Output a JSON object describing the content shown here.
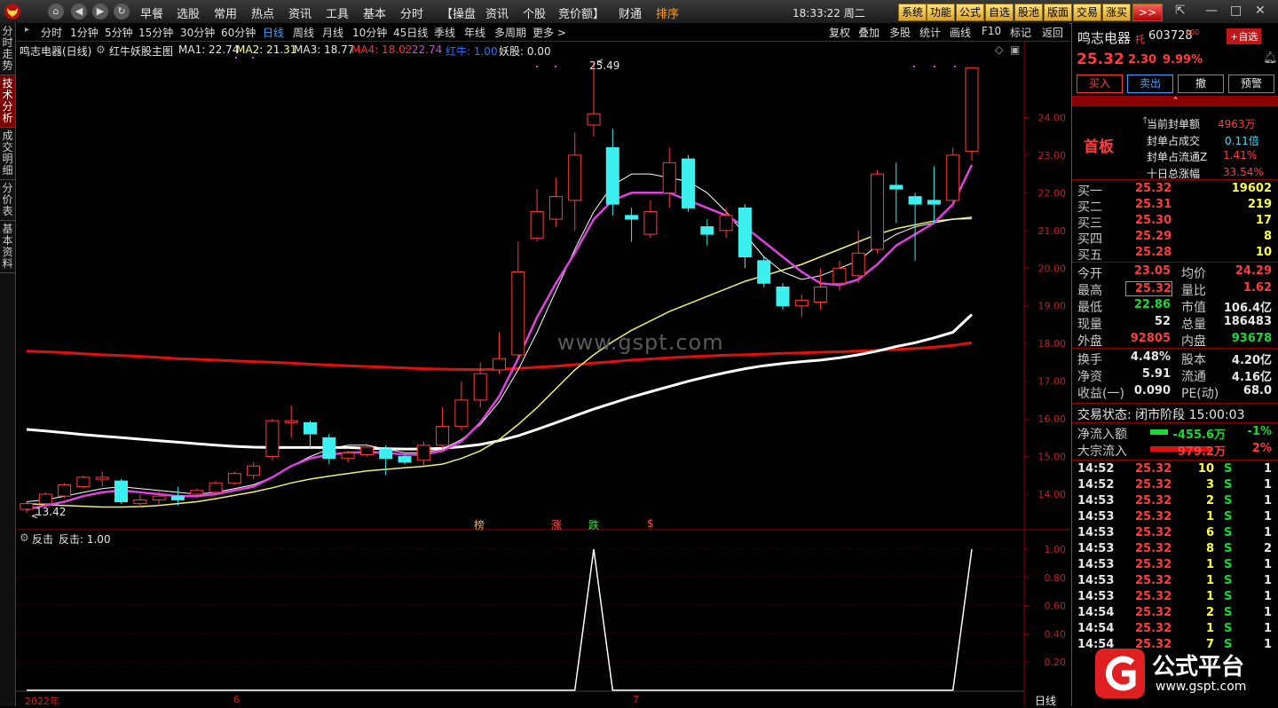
{
  "topbar": {
    "menus": [
      "早餐",
      "选股",
      "常用",
      "热点",
      "资讯",
      "工具",
      "基本",
      "分时",
      "【操盘",
      "资讯",
      "个股",
      "竞价额】",
      "财通",
      "排序"
    ],
    "clock": "18:33:22 周二",
    "buttons": [
      "系统",
      "功能",
      "公式",
      "自选",
      "股池",
      "版面",
      "交易",
      "涨买",
      ">>"
    ],
    "win_controls": [
      "⇱",
      "—",
      "□",
      "✕"
    ]
  },
  "left_tabs": [
    "分时走势",
    "技术分析",
    "成交明细",
    "分价表",
    "基本资料"
  ],
  "period_bar": {
    "periods": [
      "分时",
      "1分钟",
      "5分钟",
      "15分钟",
      "30分钟",
      "60分钟",
      "日线",
      "周线",
      "月线",
      "10分钟",
      "45日线",
      "季线",
      "年线",
      "多周期",
      "更多 >"
    ],
    "selected": "日线",
    "right": [
      "复权",
      "叠加",
      "多股",
      "统计",
      "画线",
      "F10",
      "标记",
      "返回"
    ]
  },
  "info_line": {
    "stock": "鸣志电器(日线)",
    "indicator": "红牛妖股主图",
    "ma1": "MA1: 22.74",
    "ma2": "MA2: 21.31",
    "ma3": "MA3: 18.77",
    "ma4": "MA4: 18.02",
    "val5": ": 22.74",
    "hongniu": "红牛: 1.00",
    "yaogu": "妖股: 0.00"
  },
  "sub_info": {
    "name": "反击",
    "value": "反击: 1.00"
  },
  "chart_labels": {
    "high_marker": "25.49",
    "low_marker": "13.42",
    "signals": [
      "榜",
      "涨",
      "跌",
      "$"
    ],
    "x_labels": [
      "2022年",
      "6",
      "7"
    ],
    "period_tag": "日线",
    "watermark": "www.gspt.com"
  },
  "colors": {
    "up": "#ff3c3c",
    "down": "#3cf0f0",
    "ma_magenta": "#e040e0",
    "ma_yellow": "#f0f070",
    "ma_white": "#ffffff",
    "ma_red": "#e01010",
    "accent_red": "#ff3c3c",
    "accent_green": "#18d838"
  },
  "chart_data": {
    "type": "candlestick",
    "ylim": [
      13.2,
      25.8
    ],
    "yticks": [
      14.0,
      15.0,
      16.0,
      17.0,
      18.0,
      19.0,
      20.0,
      21.0,
      22.0,
      23.0,
      24.0
    ],
    "candles": [
      [
        13.6,
        13.75,
        13.5,
        13.8
      ],
      [
        13.75,
        14.0,
        13.7,
        14.05
      ],
      [
        13.95,
        14.25,
        13.9,
        14.3
      ],
      [
        14.2,
        14.45,
        14.15,
        14.5
      ],
      [
        14.4,
        14.45,
        14.2,
        14.6
      ],
      [
        14.35,
        13.8,
        13.75,
        14.4
      ],
      [
        13.75,
        13.85,
        13.65,
        14.0
      ],
      [
        13.85,
        13.95,
        13.7,
        14.1
      ],
      [
        13.95,
        13.85,
        13.7,
        14.2
      ],
      [
        14.0,
        14.1,
        13.9,
        14.15
      ],
      [
        14.05,
        14.3,
        14.0,
        14.35
      ],
      [
        14.3,
        14.55,
        14.25,
        14.6
      ],
      [
        14.5,
        14.75,
        14.4,
        14.85
      ],
      [
        15.0,
        15.95,
        14.9,
        16.0
      ],
      [
        15.9,
        15.95,
        15.5,
        16.35
      ],
      [
        15.9,
        15.6,
        15.2,
        15.95
      ],
      [
        15.5,
        14.95,
        14.8,
        15.6
      ],
      [
        14.95,
        15.1,
        14.85,
        15.15
      ],
      [
        15.05,
        15.25,
        15.0,
        15.3
      ],
      [
        15.2,
        14.95,
        14.5,
        15.3
      ],
      [
        15.0,
        14.85,
        14.8,
        15.05
      ],
      [
        14.9,
        15.3,
        14.75,
        15.4
      ],
      [
        15.3,
        15.8,
        15.2,
        16.3
      ],
      [
        15.8,
        16.5,
        15.7,
        17.0
      ],
      [
        16.5,
        17.2,
        16.3,
        17.5
      ],
      [
        17.3,
        17.6,
        17.2,
        18.3
      ],
      [
        17.7,
        19.9,
        17.6,
        20.7
      ],
      [
        20.8,
        21.5,
        20.7,
        22.1
      ],
      [
        21.3,
        21.9,
        21.1,
        22.4
      ],
      [
        21.8,
        23.0,
        21.0,
        23.6
      ],
      [
        23.8,
        24.1,
        23.5,
        25.49
      ],
      [
        23.2,
        21.7,
        21.4,
        23.7
      ],
      [
        21.4,
        21.3,
        20.7,
        21.6
      ],
      [
        20.9,
        21.5,
        20.8,
        21.8
      ],
      [
        22.0,
        22.8,
        21.6,
        23.2
      ],
      [
        22.9,
        21.6,
        21.5,
        23.0
      ],
      [
        21.1,
        20.9,
        20.6,
        21.3
      ],
      [
        21.0,
        21.4,
        20.8,
        21.6
      ],
      [
        21.6,
        20.3,
        20.0,
        21.7
      ],
      [
        20.2,
        19.6,
        19.5,
        20.3
      ],
      [
        19.5,
        19.0,
        18.9,
        19.6
      ],
      [
        19.0,
        19.15,
        18.7,
        19.3
      ],
      [
        19.1,
        19.5,
        18.9,
        20.0
      ],
      [
        19.6,
        20.0,
        19.4,
        20.2
      ],
      [
        19.8,
        20.4,
        19.6,
        21.0
      ],
      [
        20.5,
        22.5,
        20.4,
        22.6
      ],
      [
        22.2,
        22.1,
        21.2,
        22.8
      ],
      [
        21.9,
        21.7,
        20.2,
        22.0
      ],
      [
        21.8,
        21.7,
        21.2,
        22.7
      ],
      [
        21.8,
        23.0,
        21.6,
        23.2
      ],
      [
        23.1,
        25.32,
        22.86,
        25.32
      ]
    ],
    "ma_magenta": [
      13.6,
      13.7,
      13.8,
      13.95,
      14.05,
      14.1,
      14.05,
      14.0,
      13.95,
      13.95,
      14.0,
      14.1,
      14.2,
      14.45,
      14.75,
      14.95,
      15.05,
      15.1,
      15.12,
      15.1,
      15.05,
      15.05,
      15.15,
      15.4,
      15.9,
      16.6,
      17.6,
      18.7,
      19.6,
      20.4,
      21.3,
      21.8,
      22.0,
      22.0,
      22.0,
      21.8,
      21.6,
      21.4,
      21.1,
      20.7,
      20.3,
      19.9,
      19.6,
      19.55,
      19.7,
      20.1,
      20.6,
      20.9,
      21.2,
      21.7,
      22.74
    ],
    "ma_white_thin": [
      13.8,
      13.85,
      13.95,
      14.05,
      14.15,
      14.2,
      14.15,
      14.1,
      14.05,
      14.0,
      14.05,
      14.15,
      14.25,
      14.45,
      14.75,
      15.0,
      15.2,
      15.3,
      15.3,
      15.2,
      15.1,
      15.1,
      15.2,
      15.45,
      15.85,
      16.45,
      17.3,
      18.3,
      19.4,
      20.5,
      21.5,
      22.2,
      22.5,
      22.5,
      22.4,
      22.3,
      22.0,
      21.5,
      20.9,
      20.3,
      19.9,
      19.7,
      19.8,
      20.0,
      20.2,
      20.6,
      20.9,
      21.1,
      21.2,
      21.3,
      21.31
    ],
    "ma_yellow": [
      13.75,
      13.72,
      13.7,
      13.68,
      13.66,
      13.66,
      13.67,
      13.7,
      13.75,
      13.8,
      13.88,
      13.97,
      14.06,
      14.17,
      14.3,
      14.4,
      14.48,
      14.55,
      14.62,
      14.66,
      14.7,
      14.74,
      14.8,
      14.95,
      15.15,
      15.45,
      15.85,
      16.3,
      16.8,
      17.3,
      17.7,
      18.05,
      18.35,
      18.6,
      18.85,
      19.05,
      19.25,
      19.45,
      19.65,
      19.8,
      19.95,
      20.1,
      20.3,
      20.5,
      20.7,
      20.9,
      21.05,
      21.15,
      21.25,
      21.3,
      21.35
    ],
    "ma_white_thick": [
      15.72,
      15.68,
      15.63,
      15.58,
      15.54,
      15.5,
      15.46,
      15.42,
      15.38,
      15.34,
      15.3,
      15.27,
      15.25,
      15.24,
      15.24,
      15.24,
      15.24,
      15.24,
      15.22,
      15.21,
      15.2,
      15.2,
      15.22,
      15.26,
      15.32,
      15.42,
      15.55,
      15.72,
      15.9,
      16.08,
      16.26,
      16.42,
      16.58,
      16.72,
      16.86,
      17.0,
      17.12,
      17.23,
      17.33,
      17.41,
      17.47,
      17.52,
      17.56,
      17.62,
      17.7,
      17.8,
      17.92,
      18.02,
      18.15,
      18.3,
      18.77
    ],
    "ma_red": [
      17.8,
      17.78,
      17.76,
      17.73,
      17.7,
      17.68,
      17.66,
      17.63,
      17.6,
      17.58,
      17.56,
      17.54,
      17.52,
      17.5,
      17.48,
      17.45,
      17.43,
      17.41,
      17.39,
      17.37,
      17.35,
      17.33,
      17.32,
      17.31,
      17.31,
      17.32,
      17.34,
      17.37,
      17.4,
      17.44,
      17.48,
      17.52,
      17.56,
      17.59,
      17.62,
      17.65,
      17.67,
      17.69,
      17.7,
      17.72,
      17.74,
      17.75,
      17.77,
      17.78,
      17.8,
      17.82,
      17.84,
      17.87,
      17.9,
      17.95,
      18.02
    ],
    "sub": {
      "name": "反击",
      "ylim": [
        0,
        1.05
      ],
      "yticks": [
        0.2,
        0.4,
        0.6,
        0.8,
        1.0
      ],
      "values": [
        0,
        0,
        0,
        0,
        0,
        0,
        0,
        0,
        0,
        0,
        0,
        0,
        0,
        0,
        0,
        0,
        0,
        0,
        0,
        0,
        0,
        0,
        0,
        0,
        0,
        0,
        0,
        0,
        0,
        0,
        1,
        0,
        0,
        0,
        0,
        0,
        0,
        0,
        0,
        0,
        0,
        0,
        0,
        0,
        0,
        0,
        0,
        0,
        0,
        0,
        1
      ]
    }
  },
  "right_panel": {
    "name": "鸣志电器",
    "tuo": "托",
    "code": "603728",
    "code_sup": "000",
    "add_btn": "+自选",
    "price": "25.32",
    "change": "2.30",
    "pct": "9.99%",
    "trade_btns": [
      "买入",
      "卖出",
      "撤",
      "预警"
    ],
    "shouban": "首板",
    "seal": [
      {
        "label": "当前封单额",
        "value": "4963万"
      },
      {
        "label": "封单占成交",
        "value": "0.11倍"
      },
      {
        "label": "封单占流通Z",
        "value": "1.41%"
      },
      {
        "label": "十日总涨幅",
        "value": "33.54%"
      }
    ],
    "bids": [
      {
        "label": "买一",
        "price": "25.32",
        "vol": "19602"
      },
      {
        "label": "买二",
        "price": "25.31",
        "vol": "219"
      },
      {
        "label": "买三",
        "price": "25.30",
        "vol": "17"
      },
      {
        "label": "买四",
        "price": "25.29",
        "vol": "8"
      },
      {
        "label": "买五",
        "price": "25.28",
        "vol": "10"
      }
    ],
    "quote": [
      {
        "l1": "今开",
        "v1": "23.05",
        "c1": "red",
        "l2": "均价",
        "v2": "24.29",
        "c2": "red"
      },
      {
        "l1": "最高",
        "v1": "25.32",
        "c1": "red",
        "l2": "量比",
        "v2": "1.62",
        "c2": "red"
      },
      {
        "l1": "最低",
        "v1": "22.86",
        "c1": "grn",
        "l2": "市值",
        "v2": "106.4亿",
        "c2": "wht"
      },
      {
        "l1": "现量",
        "v1": "52",
        "c1": "wht",
        "l2": "总量",
        "v2": "186483",
        "c2": "wht"
      },
      {
        "l1": "外盘",
        "v1": "92805",
        "c1": "red",
        "l2": "内盘",
        "v2": "93678",
        "c2": "grn"
      }
    ],
    "fin": [
      {
        "l1": "换手",
        "v1": "4.48%",
        "l2": "股本",
        "v2": "4.20亿"
      },
      {
        "l1": "净资",
        "v1": "5.91",
        "l2": "流通",
        "v2": "4.16亿"
      },
      {
        "l1": "收益(一)",
        "v1": "0.090",
        "l2": "PE(动)",
        "v2": "68.0"
      }
    ],
    "status": "交易状态: 闭市阶段 15:00:03",
    "flows": [
      {
        "label": "净流入额",
        "value": "-455.6万",
        "pct": "-1%",
        "color": "grn"
      },
      {
        "label": "大宗流入",
        "value": "979.2万",
        "pct": "2%",
        "color": "red"
      }
    ],
    "ticks": [
      {
        "t": "14:52",
        "p": "25.32",
        "v": "10",
        "s": "S",
        "n": "1"
      },
      {
        "t": "14:52",
        "p": "25.32",
        "v": "3",
        "s": "S",
        "n": "1"
      },
      {
        "t": "14:53",
        "p": "25.32",
        "v": "2",
        "s": "S",
        "n": "1"
      },
      {
        "t": "14:53",
        "p": "25.32",
        "v": "1",
        "s": "S",
        "n": "1"
      },
      {
        "t": "14:53",
        "p": "25.32",
        "v": "6",
        "s": "S",
        "n": "1"
      },
      {
        "t": "14:53",
        "p": "25.32",
        "v": "8",
        "s": "S",
        "n": "2"
      },
      {
        "t": "14:53",
        "p": "25.32",
        "v": "1",
        "s": "S",
        "n": "1"
      },
      {
        "t": "14:53",
        "p": "25.32",
        "v": "1",
        "s": "S",
        "n": "1"
      },
      {
        "t": "14:53",
        "p": "25.32",
        "v": "1",
        "s": "S",
        "n": "1"
      },
      {
        "t": "14:54",
        "p": "25.32",
        "v": "2",
        "s": "S",
        "n": "1"
      },
      {
        "t": "14:54",
        "p": "25.32",
        "v": "1",
        "s": "S",
        "n": "1"
      },
      {
        "t": "14:54",
        "p": "25.32",
        "v": "7",
        "s": "S",
        "n": "1"
      }
    ],
    "brand": {
      "cn": "公式平台",
      "url": "www.gspt.com"
    }
  }
}
